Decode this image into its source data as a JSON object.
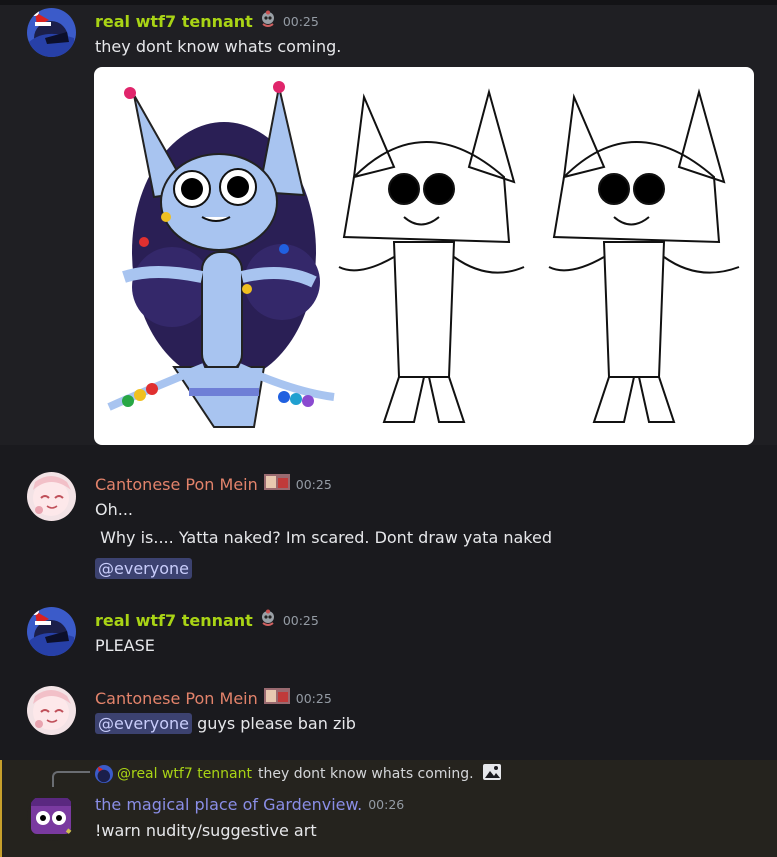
{
  "messages": [
    {
      "author": "real wtf7 tennant",
      "time": "00:25",
      "text": "they dont know whats coming."
    },
    {
      "author": "Cantonese Pon Mein",
      "time": "00:25",
      "lines": [
        "Oh...",
        " Why is.... Yatta naked? Im scared. Dont draw yata naked"
      ],
      "mention": "@everyone"
    },
    {
      "author": "real wtf7 tennant",
      "time": "00:25",
      "text": "PLEASE"
    },
    {
      "author": "Cantonese Pon Mein",
      "time": "00:25",
      "mention": "@everyone",
      "text": " guys please ban zib"
    },
    {
      "reply": {
        "author": "@real wtf7 tennant",
        "text": "they dont know whats coming."
      },
      "author": "the magical place of Gardenview.",
      "time": "00:26",
      "text": "!warn nudity/suggestive art"
    }
  ],
  "colors": {
    "background": "#1a1a1e",
    "name_lime": "#a9d415",
    "name_salmon": "#e3836b",
    "name_violet": "#8a8ee6",
    "mention_bg": "#3c4270",
    "reply_highlight": "#25231e"
  },
  "icons": [
    "santa-avatar",
    "catgirl-avatar",
    "purple-robot-avatar",
    "role-badge-icon",
    "image-icon"
  ]
}
